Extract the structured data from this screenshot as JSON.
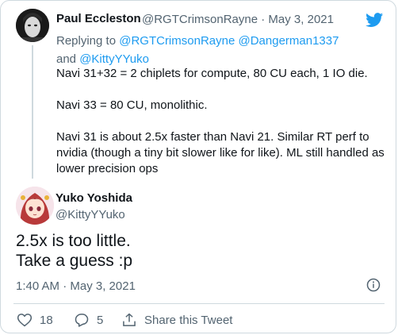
{
  "parent_tweet": {
    "author_name": "Paul Eccleston",
    "handle_date": "@RGTCrimsonRayne · May 3, 2021",
    "replying_prefix": "Replying to",
    "replying_to": [
      "@RGTCrimsonRayne",
      "@Dangerman1337",
      "and",
      "@KittyYYuko"
    ],
    "text_lines": [
      "Navi 31+32 = 2 chiplets for compute, 80 CU each, 1 IO die.",
      "Navi 33 = 80 CU, monolithic.",
      "Navi 31 is about 2.5x faster than Navi 21. Similar RT perf to nvidia (though a tiny bit slower like for like). ML still handled as lower precision ops"
    ]
  },
  "main_tweet": {
    "author_name": "Yuko Yoshida",
    "handle": "@KittyYYuko",
    "text_line1": "2.5x is too little.",
    "text_line2": "Take a guess :p",
    "timestamp": "1:40 AM · May 3, 2021"
  },
  "actions": {
    "like_count": "18",
    "reply_count": "5",
    "share_label": "Share this Tweet"
  },
  "icons": {
    "brand": "twitter-bird-icon",
    "info": "info-icon",
    "like": "heart-icon",
    "reply": "reply-icon",
    "share": "share-icon"
  },
  "colors": {
    "link": "#1d9bf0",
    "secondary_text": "#536471",
    "border": "#cfd9de",
    "brand": "#1d9bf0"
  }
}
